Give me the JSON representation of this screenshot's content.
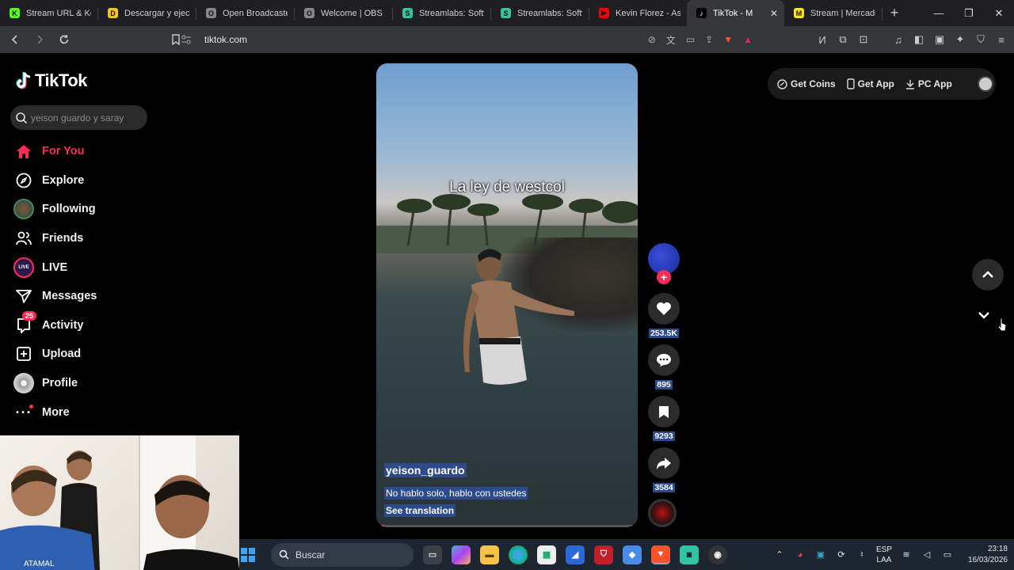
{
  "browser": {
    "tabs": [
      {
        "title": "Stream URL & Key",
        "fav_color": "#53fc18",
        "fav_glyph": "K",
        "active": false
      },
      {
        "title": "Descargar y ejecut",
        "fav_color": "#f5c518",
        "fav_glyph": "D",
        "active": false
      },
      {
        "title": "Open Broadcaster",
        "fav_color": "#888888",
        "fav_glyph": "O",
        "active": false
      },
      {
        "title": "Welcome | OBS",
        "fav_color": "#888888",
        "fav_glyph": "O",
        "active": false
      },
      {
        "title": "Streamlabs: Softw",
        "fav_color": "#31c3a2",
        "fav_glyph": "S",
        "active": false
      },
      {
        "title": "Streamlabs: Softw",
        "fav_color": "#31c3a2",
        "fav_glyph": "S",
        "active": false
      },
      {
        "title": "Kevin Florez - Aso",
        "fav_color": "#ff0000",
        "fav_glyph": "▶",
        "active": false
      },
      {
        "title": "TikTok - M",
        "fav_color": "#000000",
        "fav_glyph": "♪",
        "active": true
      },
      {
        "title": "Stream | Mercadol",
        "fav_color": "#ffe600",
        "fav_glyph": "M",
        "active": false
      }
    ],
    "url": "tiktok.com"
  },
  "tiktok": {
    "logo": "TikTok",
    "search_placeholder": "yeison guardo y saray",
    "nav": [
      {
        "label": "For You",
        "icon": "home-icon",
        "active": true
      },
      {
        "label": "Explore",
        "icon": "compass-icon",
        "active": false
      },
      {
        "label": "Following",
        "icon": "following-avatar-icon",
        "active": false
      },
      {
        "label": "Friends",
        "icon": "friends-icon",
        "active": false
      },
      {
        "label": "LIVE",
        "icon": "live-icon",
        "active": false
      },
      {
        "label": "Messages",
        "icon": "messages-icon",
        "active": false
      },
      {
        "label": "Activity",
        "icon": "activity-icon",
        "active": false,
        "badge": "25"
      },
      {
        "label": "Upload",
        "icon": "upload-icon",
        "active": false
      },
      {
        "label": "Profile",
        "icon": "profile-icon",
        "active": false
      },
      {
        "label": "More",
        "icon": "more-icon",
        "active": false
      }
    ],
    "header": {
      "get_coins": "Get Coins",
      "get_app": "Get App",
      "pc_app": "PC App"
    },
    "video": {
      "overlay_text": "La ley de westcol",
      "author": "yeison_guardo",
      "description": "No hablo solo, hablo con ustedes",
      "see_translation": "See translation",
      "progress": 0.03
    },
    "actions": {
      "likes": "253.5K",
      "comments": "895",
      "saves": "9293",
      "shares": "3584"
    }
  },
  "taskbar": {
    "search_label": "Buscar",
    "lang_top": "ESP",
    "lang_bottom": "LAA",
    "time": "23:18",
    "date": "16/03/2026"
  },
  "colors": {
    "accent": "#fe2c55",
    "highlight": "#2d4a8a"
  }
}
